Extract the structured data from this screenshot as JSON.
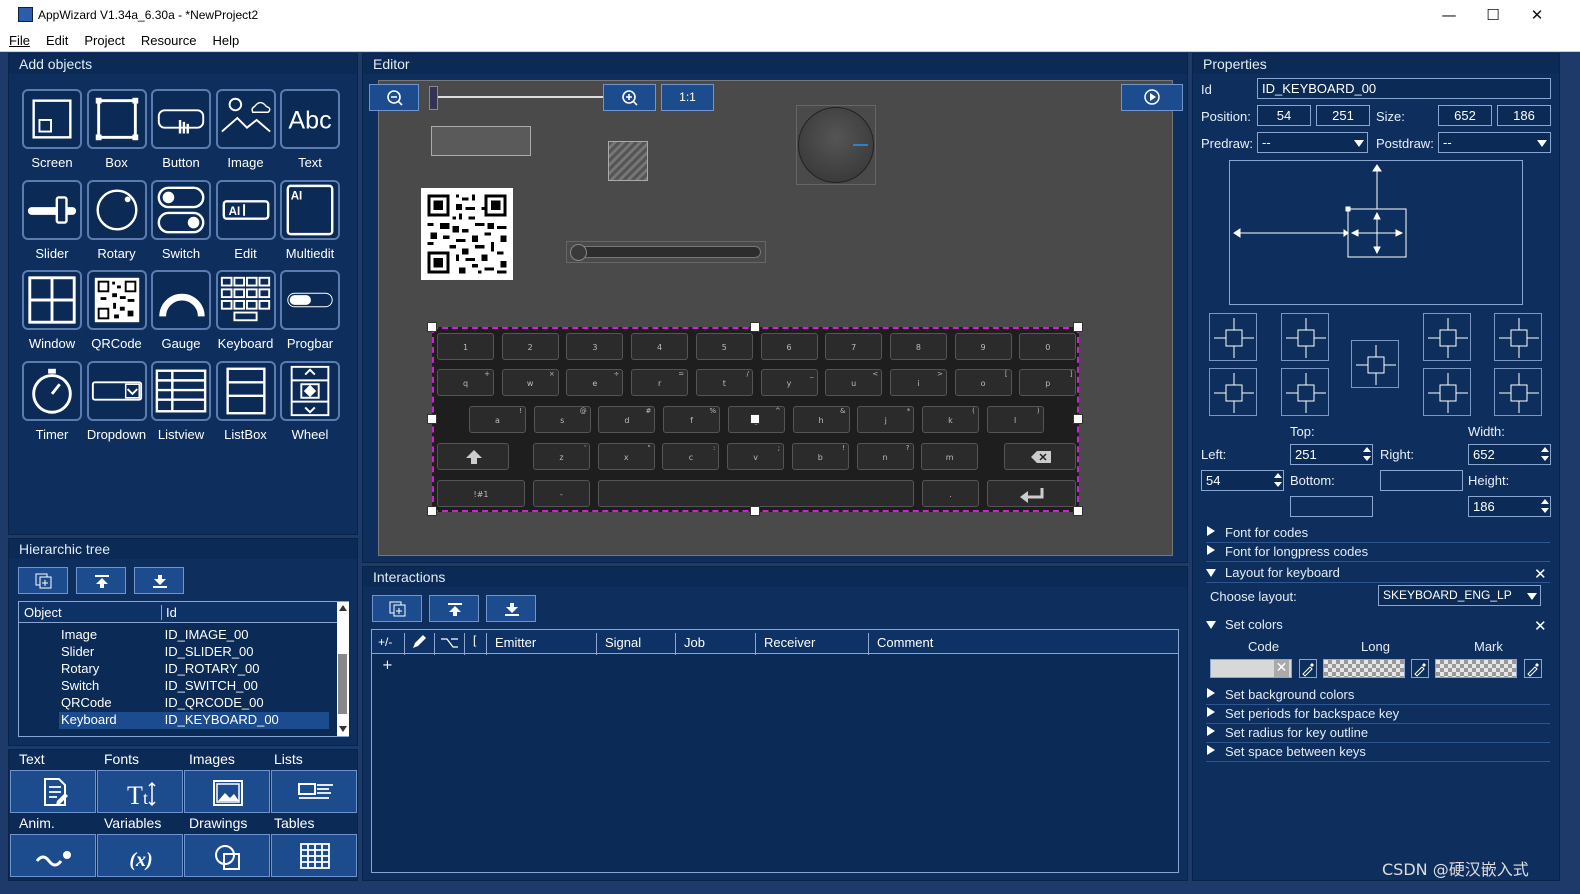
{
  "window": {
    "title": "AppWizard V1.34a_6.30a - *NewProject2"
  },
  "menu": [
    "File",
    "Edit",
    "Project",
    "Resource",
    "Help"
  ],
  "panels": {
    "add_objects": "Add objects",
    "editor": "Editor",
    "properties": "Properties",
    "tree": "Hierarchic tree",
    "interactions": "Interactions"
  },
  "objects": [
    "Screen",
    "Box",
    "Button",
    "Image",
    "Text",
    "Slider",
    "Rotary",
    "Switch",
    "Edit",
    "Multiedit",
    "Window",
    "QRCode",
    "Gauge",
    "Keyboard",
    "Progbar",
    "Timer",
    "Dropdown",
    "Listview",
    "ListBox",
    "Wheel"
  ],
  "editor": {
    "zoom_ratio": "1:1",
    "zoom_level": 0.02
  },
  "keyboard": {
    "row1": [
      "1",
      "2",
      "3",
      "4",
      "5",
      "6",
      "7",
      "8",
      "9",
      "0"
    ],
    "row2": [
      "q",
      "w",
      "e",
      "r",
      "t",
      "y",
      "u",
      "i",
      "o",
      "p"
    ],
    "row2_alt": [
      "+",
      "×",
      "÷",
      "=",
      "/",
      "_",
      "<",
      ">",
      "[",
      "]"
    ],
    "row3": [
      "a",
      "s",
      "d",
      "f",
      "g",
      "h",
      "j",
      "k",
      "l"
    ],
    "row3_alt": [
      "!",
      "@",
      "#",
      "%",
      "^",
      "&",
      "*",
      "(",
      ")"
    ],
    "row4": [
      "z",
      "x",
      "c",
      "v",
      "b",
      "n",
      "m"
    ],
    "row4_alt": [
      "'",
      "\"",
      ":",
      ";",
      "!",
      "?"
    ],
    "row5": [
      "!#1",
      "-",
      ".",
      ""
    ]
  },
  "tree": {
    "col_object": "Object",
    "col_id": "Id",
    "rows": [
      {
        "object": "Image",
        "id": "ID_IMAGE_00"
      },
      {
        "object": "Slider",
        "id": "ID_SLIDER_00"
      },
      {
        "object": "Rotary",
        "id": "ID_ROTARY_00"
      },
      {
        "object": "Switch",
        "id": "ID_SWITCH_00"
      },
      {
        "object": "QRCode",
        "id": "ID_QRCODE_00"
      },
      {
        "object": "Keyboard",
        "id": "ID_KEYBOARD_00"
      }
    ]
  },
  "resources": {
    "row1": [
      "Text",
      "Fonts",
      "Images",
      "Lists"
    ],
    "row2": [
      "Anim.",
      "Variables",
      "Drawings",
      "Tables"
    ]
  },
  "interactions": {
    "columns": [
      "+/-",
      "",
      "",
      "[",
      "Emitter",
      "Signal",
      "Job",
      "Receiver",
      "Comment"
    ],
    "add": "+"
  },
  "properties": {
    "id_label": "Id",
    "id_value": "ID_KEYBOARD_00",
    "position_label": "Position:",
    "pos_x": "54",
    "pos_y": "251",
    "size_label": "Size:",
    "size_w": "652",
    "size_h": "186",
    "predraw_label": "Predraw:",
    "predraw_value": "--",
    "postdraw_label": "Postdraw:",
    "postdraw_value": "--",
    "top_label": "Top:",
    "top_value": "251",
    "width_label": "Width:",
    "width_value": "652",
    "left_label": "Left:",
    "left_value": "54",
    "right_label": "Right:",
    "right_value": "",
    "bottom_label": "Bottom:",
    "bottom_value": "",
    "height_label": "Height:",
    "height_value": "186",
    "sections": [
      "Font for codes",
      "Font for longpress codes",
      "Layout for keyboard"
    ],
    "choose_layout_label": "Choose layout:",
    "layout_value": "SKEYBOARD_ENG_LP",
    "set_colors": "Set colors",
    "color_cols": [
      "Code",
      "Long",
      "Mark"
    ],
    "more_sections": [
      "Set background colors",
      "Set periods for backspace key",
      "Set radius for key outline",
      "Set space between keys"
    ]
  },
  "watermark": "CSDN @硬汉嵌入式"
}
